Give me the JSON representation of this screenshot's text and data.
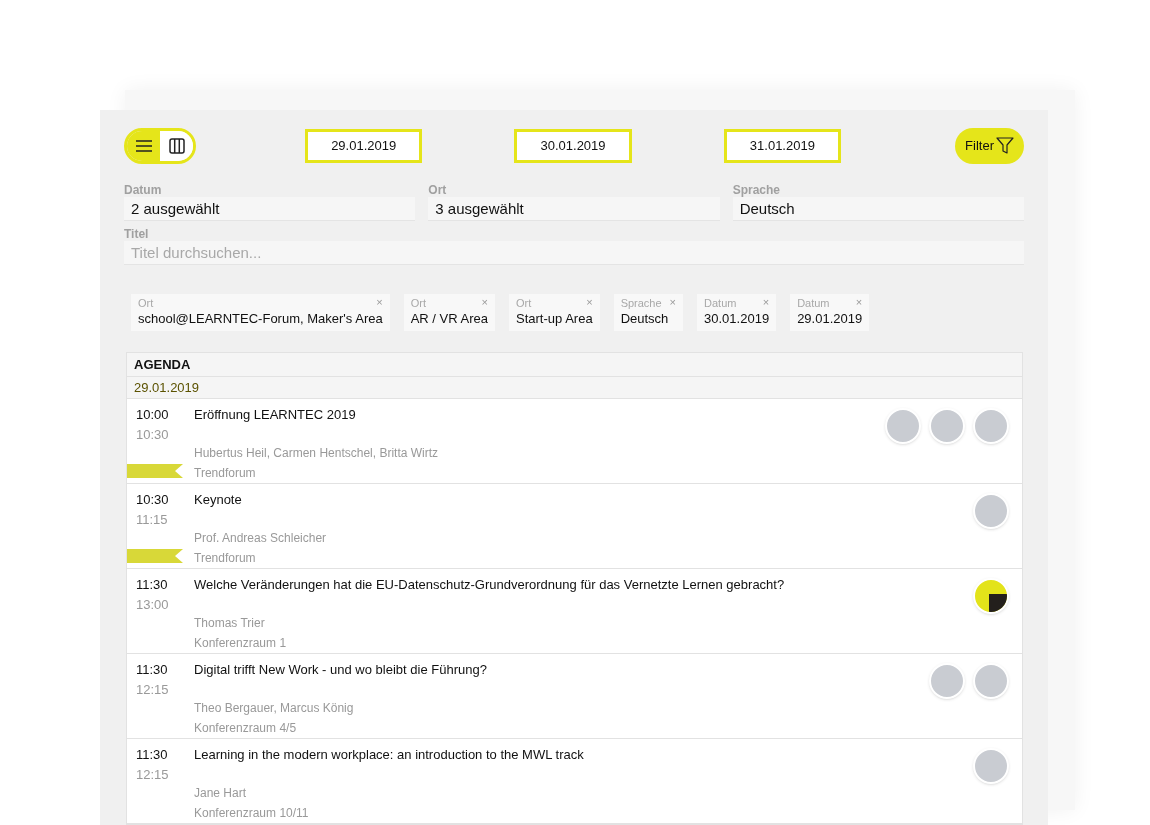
{
  "toolbar": {
    "views": [
      {
        "kind": "list",
        "selected": true
      },
      {
        "kind": "columns",
        "selected": false
      }
    ],
    "dates": [
      {
        "label": "29.01.2019"
      },
      {
        "label": "30.01.2019"
      },
      {
        "label": "31.01.2019"
      }
    ],
    "filter_button": "Filter"
  },
  "fields": [
    {
      "label": "Datum",
      "value": "2 ausgewählt"
    },
    {
      "label": "Ort",
      "value": "3 ausgewählt"
    },
    {
      "label": "Sprache",
      "value": "Deutsch"
    }
  ],
  "title_field": {
    "label": "Titel",
    "placeholder": "Titel durchsuchen..."
  },
  "chips": [
    {
      "label": "Ort",
      "value": "school@LEARNTEC-Forum, Maker's Area",
      "remove": "×"
    },
    {
      "label": "Ort",
      "value": "AR / VR Area",
      "remove": "×"
    },
    {
      "label": "Ort",
      "value": "Start-up Area",
      "remove": "×"
    },
    {
      "label": "Sprache",
      "value": "Deutsch",
      "remove": "×"
    },
    {
      "label": "Datum",
      "value": "30.01.2019",
      "remove": "×"
    },
    {
      "label": "Datum",
      "value": "29.01.2019",
      "remove": "×"
    }
  ],
  "agenda": {
    "title": "AGENDA",
    "day": "29.01.2019",
    "sessions": [
      {
        "start": "10:00",
        "end": "10:30",
        "title": "Eröffnung LEARNTEC 2019",
        "speakers": "Hubertus Heil, Carmen Hentschel, Britta Wirtz",
        "room": "Trendforum",
        "flagged": true,
        "avatars": [
          {
            "kind": "photo"
          },
          {
            "kind": "photo"
          },
          {
            "kind": "photo"
          }
        ]
      },
      {
        "start": "10:30",
        "end": "11:15",
        "title": "Keynote",
        "speakers": "Prof. Andreas Schleicher",
        "room": "Trendforum",
        "flagged": true,
        "avatars": [
          {
            "kind": "photo"
          }
        ]
      },
      {
        "start": "11:30",
        "end": "13:00",
        "title": "Welche Veränderungen hat die EU-Datenschutz-Grundverordnung für das Vernetzte Lernen gebracht?",
        "speakers": "Thomas Trier",
        "room": "Konferenzraum 1",
        "flagged": false,
        "avatars": [
          {
            "kind": "logo"
          }
        ]
      },
      {
        "start": "11:30",
        "end": "12:15",
        "title": "Digital trifft New Work - und wo bleibt die Führung?",
        "speakers": "Theo Bergauer, Marcus König",
        "room": "Konferenzraum 4/5",
        "flagged": false,
        "avatars": [
          {
            "kind": "photo"
          },
          {
            "kind": "photo"
          }
        ]
      },
      {
        "start": "11:30",
        "end": "12:15",
        "title": "Learning in the modern workplace: an introduction to the MWL track",
        "speakers": "Jane Hart",
        "room": "Konferenzraum 10/11",
        "flagged": false,
        "avatars": [
          {
            "kind": "photo"
          }
        ]
      }
    ]
  }
}
